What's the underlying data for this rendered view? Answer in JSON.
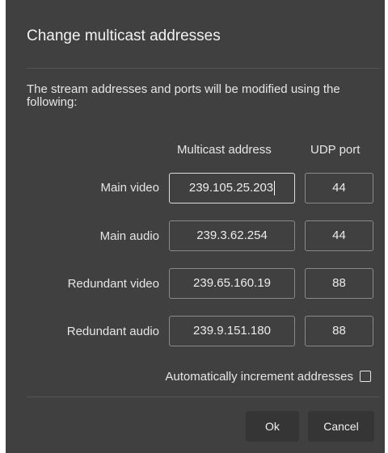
{
  "dialog": {
    "title": "Change multicast addresses",
    "description": "The stream addresses and ports will be modified using the following:",
    "headers": {
      "address": "Multicast address",
      "port": "UDP port"
    },
    "rows": [
      {
        "label": "Main video",
        "address": "239.105.25.203",
        "port": "44"
      },
      {
        "label": "Main audio",
        "address": "239.3.62.254",
        "port": "44"
      },
      {
        "label": "Redundant video",
        "address": "239.65.160.19",
        "port": "88"
      },
      {
        "label": "Redundant audio",
        "address": "239.9.151.180",
        "port": "88"
      }
    ],
    "auto_increment_label": "Automatically increment addresses",
    "auto_increment_checked": false,
    "ok_label": "Ok",
    "cancel_label": "Cancel"
  },
  "colors": {
    "background": "#404040",
    "button": "#353535",
    "text": "#e6e6e6",
    "field_border": "#8a8a8a"
  }
}
